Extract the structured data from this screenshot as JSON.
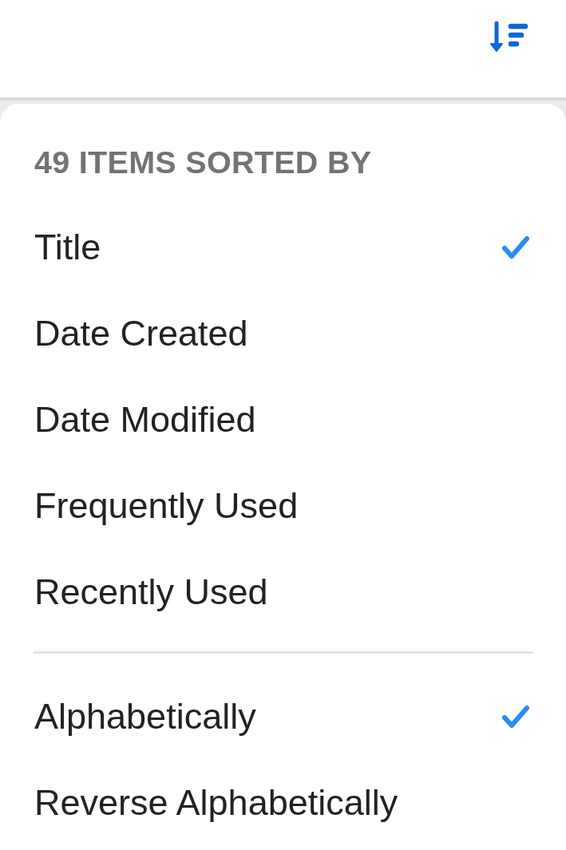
{
  "sort_menu": {
    "header": "49 ITEMS SORTED BY",
    "sort_fields": [
      {
        "label": "Title",
        "selected": true
      },
      {
        "label": "Date Created",
        "selected": false
      },
      {
        "label": "Date Modified",
        "selected": false
      },
      {
        "label": "Frequently Used",
        "selected": false
      },
      {
        "label": "Recently Used",
        "selected": false
      }
    ],
    "sort_orders": [
      {
        "label": "Alphabetically",
        "selected": true
      },
      {
        "label": "Reverse Alphabetically",
        "selected": false
      }
    ]
  }
}
